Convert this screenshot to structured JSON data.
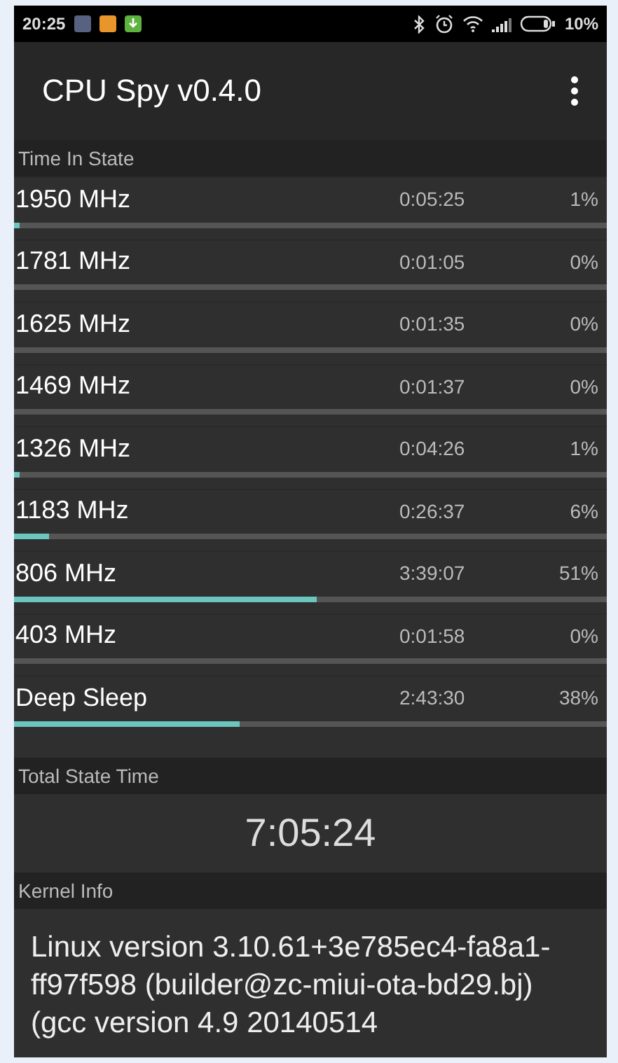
{
  "status_bar": {
    "time": "20:25",
    "battery": "10%"
  },
  "app_bar": {
    "title": "CPU Spy v0.4.0"
  },
  "time_in_state": {
    "header": "Time In State",
    "rows": [
      {
        "state": "1950 MHz",
        "time": "0:05:25",
        "percent": "1%",
        "level": 0.01
      },
      {
        "state": "1781 MHz",
        "time": "0:01:05",
        "percent": "0%"
      },
      {
        "state": "1625 MHz",
        "time": "0:01:35",
        "percent": "0%"
      },
      {
        "state": "1469 MHz",
        "time": "0:01:37",
        "percent": "0%"
      },
      {
        "state": "1326 MHz",
        "time": "0:04:26",
        "percent": "1%",
        "level": 0.01
      },
      {
        "state": "1183 MHz",
        "time": "0:26:37",
        "percent": "6%",
        "level": 0.06
      },
      {
        "state": "806 MHz",
        "time": "3:39:07",
        "percent": "51%",
        "level": 0.51
      },
      {
        "state": "403 MHz",
        "time": "0:01:58",
        "percent": "0%"
      },
      {
        "state": "Deep Sleep",
        "time": "2:43:30",
        "percent": "38%",
        "level": 0.38
      }
    ]
  },
  "total_state_time": {
    "header": "Total State Time",
    "value": "7:05:24"
  },
  "kernel_info": {
    "header": "Kernel Info",
    "text": "Linux version 3.10.61+3e785ec4-fa8a1-ff97f598 (builder@zc-miui-ota-bd29.bj) (gcc version 4.9 20140514"
  }
}
